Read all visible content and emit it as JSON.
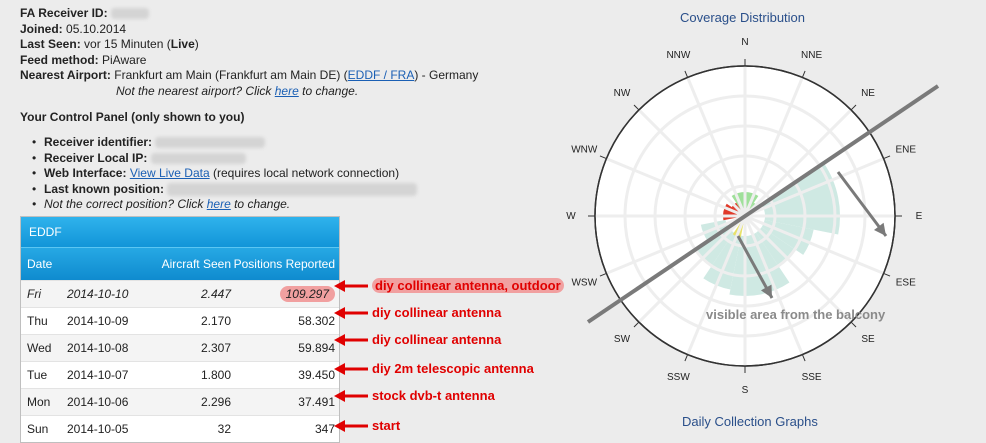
{
  "info": {
    "receiver_id_label": "FA Receiver ID:",
    "joined_label": "Joined:",
    "joined": "05.10.2014",
    "last_seen_label": "Last Seen:",
    "last_seen": "vor 15 Minuten (",
    "last_seen_live": "Live",
    "last_seen_close": ")",
    "feed_label": "Feed method:",
    "feed": "PiAware",
    "airport_label": "Nearest Airport:",
    "airport": "Frankfurt am Main (Frankfurt am Main DE) (",
    "airport_link": "EDDF / FRA",
    "airport_tail": ") - Germany",
    "not_airport": "Not the nearest airport? Click ",
    "here": "here",
    "to_change": " to change."
  },
  "control_panel": {
    "title": "Your Control Panel (only shown to you)",
    "identifier_label": "Receiver identifier:",
    "local_ip_label": "Receiver Local IP:",
    "web_label": "Web Interface:",
    "web_link": "View Live Data",
    "web_tail": " (requires local network connection)",
    "position_label": "Last known position:",
    "not_position": "Not the correct position? Click ",
    "here": "here",
    "to_change": " to change."
  },
  "table": {
    "title": "EDDF",
    "columns": [
      "Date",
      "Aircraft Seen",
      "Positions Reported"
    ],
    "rows": [
      {
        "day": "Fri",
        "date": "2014-10-10",
        "aircraft": "2.447",
        "positions": "109.297"
      },
      {
        "day": "Thu",
        "date": "2014-10-09",
        "aircraft": "2.170",
        "positions": "58.302"
      },
      {
        "day": "Wed",
        "date": "2014-10-08",
        "aircraft": "2.307",
        "positions": "59.894"
      },
      {
        "day": "Tue",
        "date": "2014-10-07",
        "aircraft": "1.800",
        "positions": "39.450"
      },
      {
        "day": "Mon",
        "date": "2014-10-06",
        "aircraft": "2.296",
        "positions": "37.491"
      },
      {
        "day": "Sun",
        "date": "2014-10-05",
        "aircraft": "32",
        "positions": "347"
      }
    ]
  },
  "annotations": [
    "diy collinear antenna, outdoor",
    "diy collinear antenna",
    "diy collinear antenna",
    "diy 2m telescopic antenna",
    "stock dvb-t antenna",
    "start"
  ],
  "chart": {
    "title": "Coverage Distribution",
    "footer": "Daily Collection Graphs",
    "directions": [
      "N",
      "NNE",
      "NE",
      "ENE",
      "E",
      "ESE",
      "SE",
      "SSE",
      "S",
      "SSW",
      "SW",
      "WSW",
      "W",
      "WNW",
      "NW",
      "NNW"
    ],
    "balcony_text": "visible area from the balcony",
    "colors": {
      "red": "#e03a2a",
      "green": "#9fe09a",
      "yellow": "#e8e26a",
      "teal": "#cfe9e3"
    }
  }
}
